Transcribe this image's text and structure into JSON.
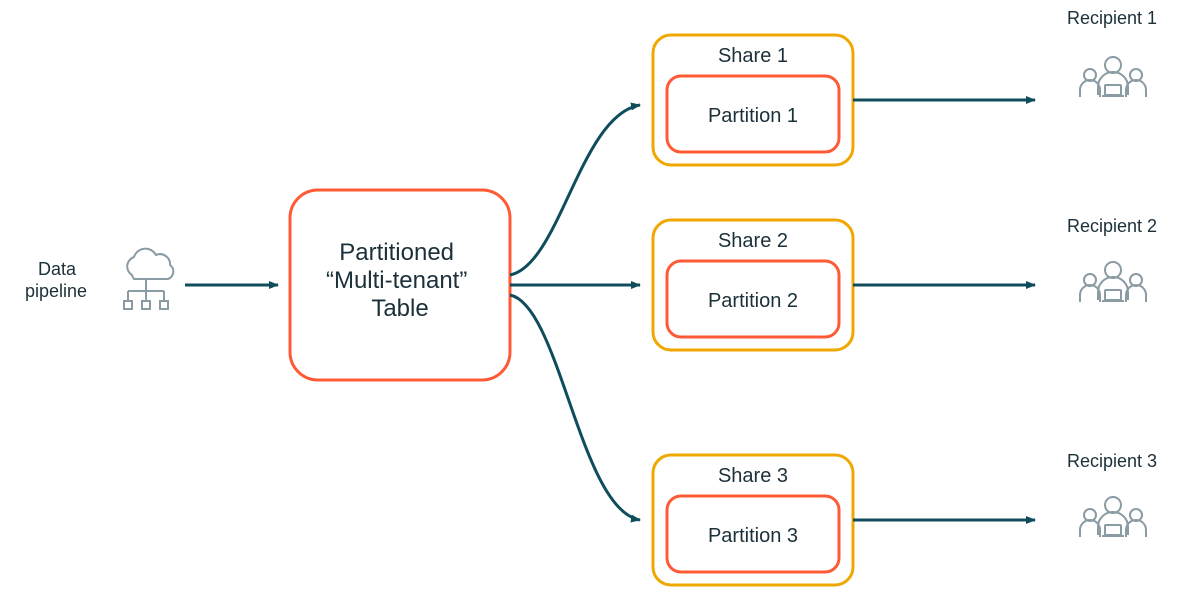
{
  "source": {
    "label": "Data\npipeline"
  },
  "table": {
    "line1": "Partitioned",
    "line2": "“Multi-tenant”",
    "line3": "Table"
  },
  "shares": [
    {
      "share_label": "Share 1",
      "partition_label": "Partition 1",
      "recipient_label": "Recipient 1"
    },
    {
      "share_label": "Share 2",
      "partition_label": "Partition 2",
      "recipient_label": "Recipient 2"
    },
    {
      "share_label": "Share 3",
      "partition_label": "Partition 3",
      "recipient_label": "Recipient 3"
    }
  ],
  "colors": {
    "orange": "#ff5a36",
    "yellow": "#f0a800",
    "teal": "#0f4c5c",
    "icon": "#8b9ba3"
  }
}
